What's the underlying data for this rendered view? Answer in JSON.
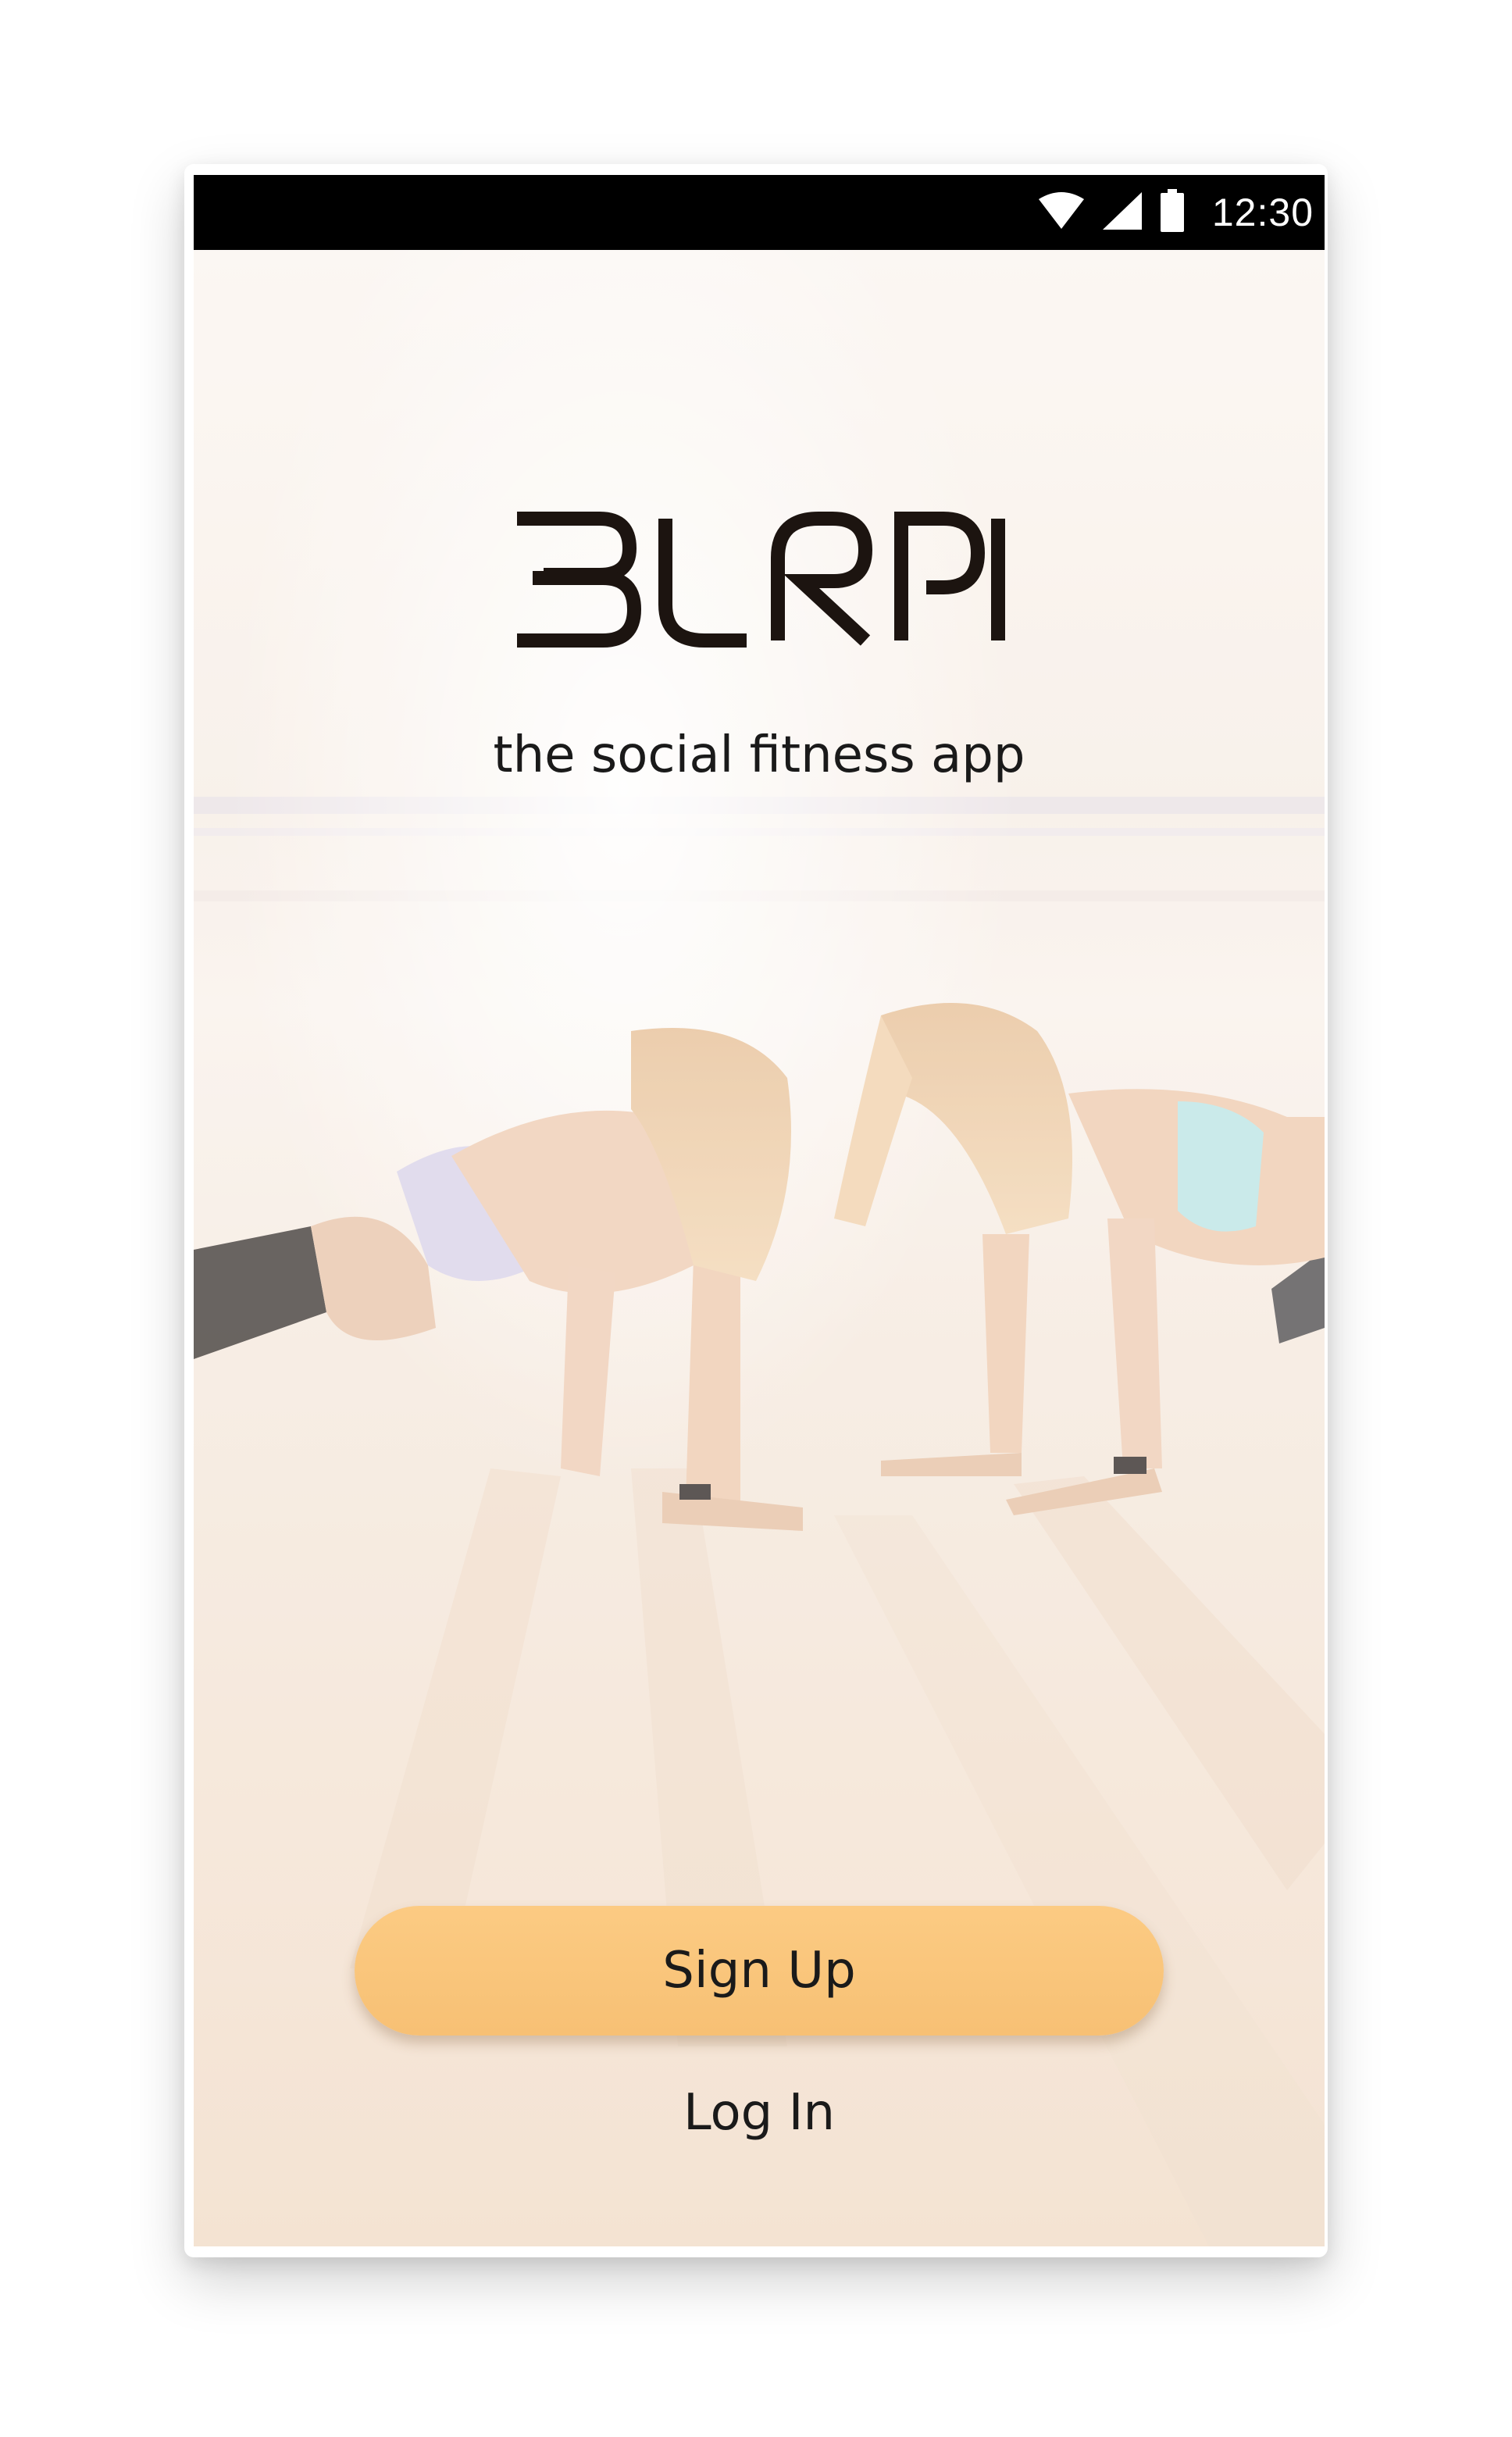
{
  "status_bar": {
    "time": "12:30",
    "icons": [
      "wifi-icon",
      "cellular-signal-icon",
      "battery-icon"
    ]
  },
  "app": {
    "logo_text": "BURPI",
    "tagline": "the social fitness app",
    "signup_label": "Sign Up",
    "login_label": "Log In"
  },
  "colors": {
    "status_bar": "#000000",
    "signup_button": "#fbc77f",
    "text": "#1a1a1a",
    "hero_tint": "#f6ebe0"
  }
}
